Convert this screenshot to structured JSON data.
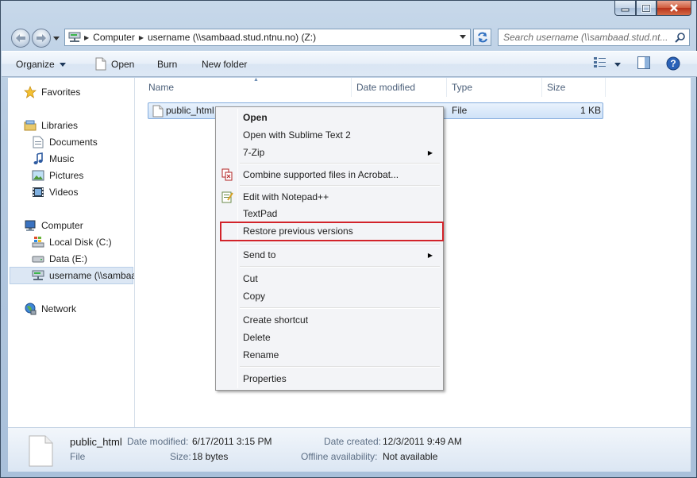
{
  "window": {
    "address": {
      "crumbs": [
        "Computer",
        "username (\\\\sambaad.stud.ntnu.no) (Z:)"
      ]
    },
    "search": {
      "placeholder": "Search username (\\\\sambaad.stud.nt..."
    }
  },
  "toolbar": {
    "organize": "Organize",
    "open": "Open",
    "burn": "Burn",
    "new_folder": "New folder"
  },
  "nav": {
    "favorites": "Favorites",
    "libraries": "Libraries",
    "documents": "Documents",
    "music": "Music",
    "pictures": "Pictures",
    "videos": "Videos",
    "computer": "Computer",
    "local_disk": "Local Disk (C:)",
    "data": "Data (E:)",
    "username_drive": "username (\\\\sambaad.stud.ntnu.no) (Z:)",
    "network": "Network"
  },
  "columns": {
    "name": "Name",
    "date_modified": "Date modified",
    "type": "Type",
    "size": "Size"
  },
  "file": {
    "name": "public_html",
    "type": "File",
    "size": "1 KB"
  },
  "context_menu": {
    "open": "Open",
    "open_sublime": "Open with Sublime Text 2",
    "seven_zip": "7-Zip",
    "combine_acrobat": "Combine supported files in Acrobat...",
    "edit_notepad": "Edit with Notepad++",
    "textpad": "TextPad",
    "restore": "Restore previous versions",
    "send_to": "Send to",
    "cut": "Cut",
    "copy": "Copy",
    "create_shortcut": "Create shortcut",
    "delete": "Delete",
    "rename": "Rename",
    "properties": "Properties"
  },
  "details": {
    "name": "public_html",
    "kind": "File",
    "date_modified_label": "Date modified:",
    "date_modified": "6/17/2011 3:15 PM",
    "size_label": "Size:",
    "size": "18 bytes",
    "date_created_label": "Date created:",
    "date_created": "12/3/2011 9:49 AM",
    "offline_label": "Offline availability:",
    "offline": "Not available"
  },
  "colors": {
    "highlight_border": "#d2232a",
    "selection": "#cfe2f8"
  }
}
